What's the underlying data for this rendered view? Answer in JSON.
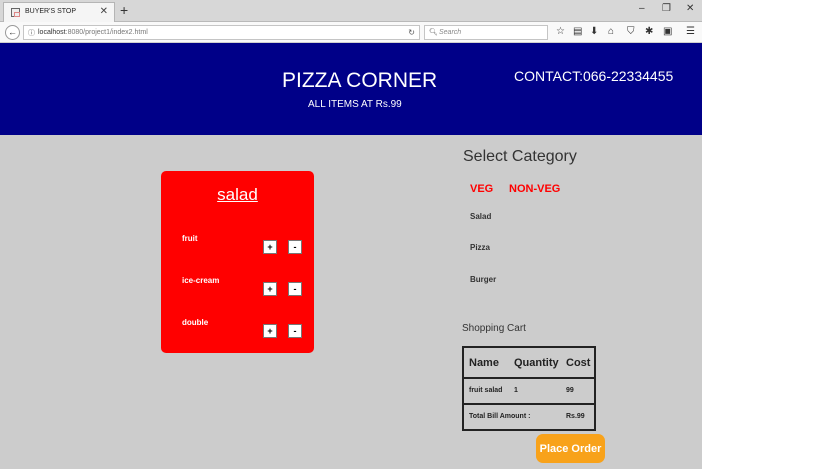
{
  "browser": {
    "tab_title": "BUYER'S STOP",
    "url_host": "localhost",
    "url_rest": ":8080/project1/index2.html",
    "search_placeholder": "Search"
  },
  "header": {
    "brand": "PIZZA CORNER",
    "subtitle": "ALL ITEMS AT Rs.99",
    "contact": "CONTACT:066-22334455"
  },
  "menu_card": {
    "title": "salad",
    "items": [
      {
        "name": "fruit",
        "plus": "+",
        "minus": "-"
      },
      {
        "name": "ice-cream",
        "plus": "+",
        "minus": "-"
      },
      {
        "name": "double",
        "plus": "+",
        "minus": "-"
      }
    ]
  },
  "category": {
    "heading": "Select Category",
    "tabs": [
      "VEG",
      "NON-VEG"
    ],
    "items": [
      "Salad",
      "Pizza",
      "Burger"
    ]
  },
  "cart": {
    "heading": "Shopping Cart",
    "columns": [
      "Name",
      "Quantity",
      "Cost"
    ],
    "rows": [
      {
        "name": "fruit salad",
        "quantity": "1",
        "cost": "99"
      }
    ],
    "total_label": "Total Bill Amount :",
    "total_value": "Rs.99",
    "place_order": "Place Order"
  },
  "colors": {
    "header_bg": "#000088",
    "card_bg": "#ff0000",
    "button_bg": "#f8a21a",
    "page_bg": "#cccccc"
  }
}
